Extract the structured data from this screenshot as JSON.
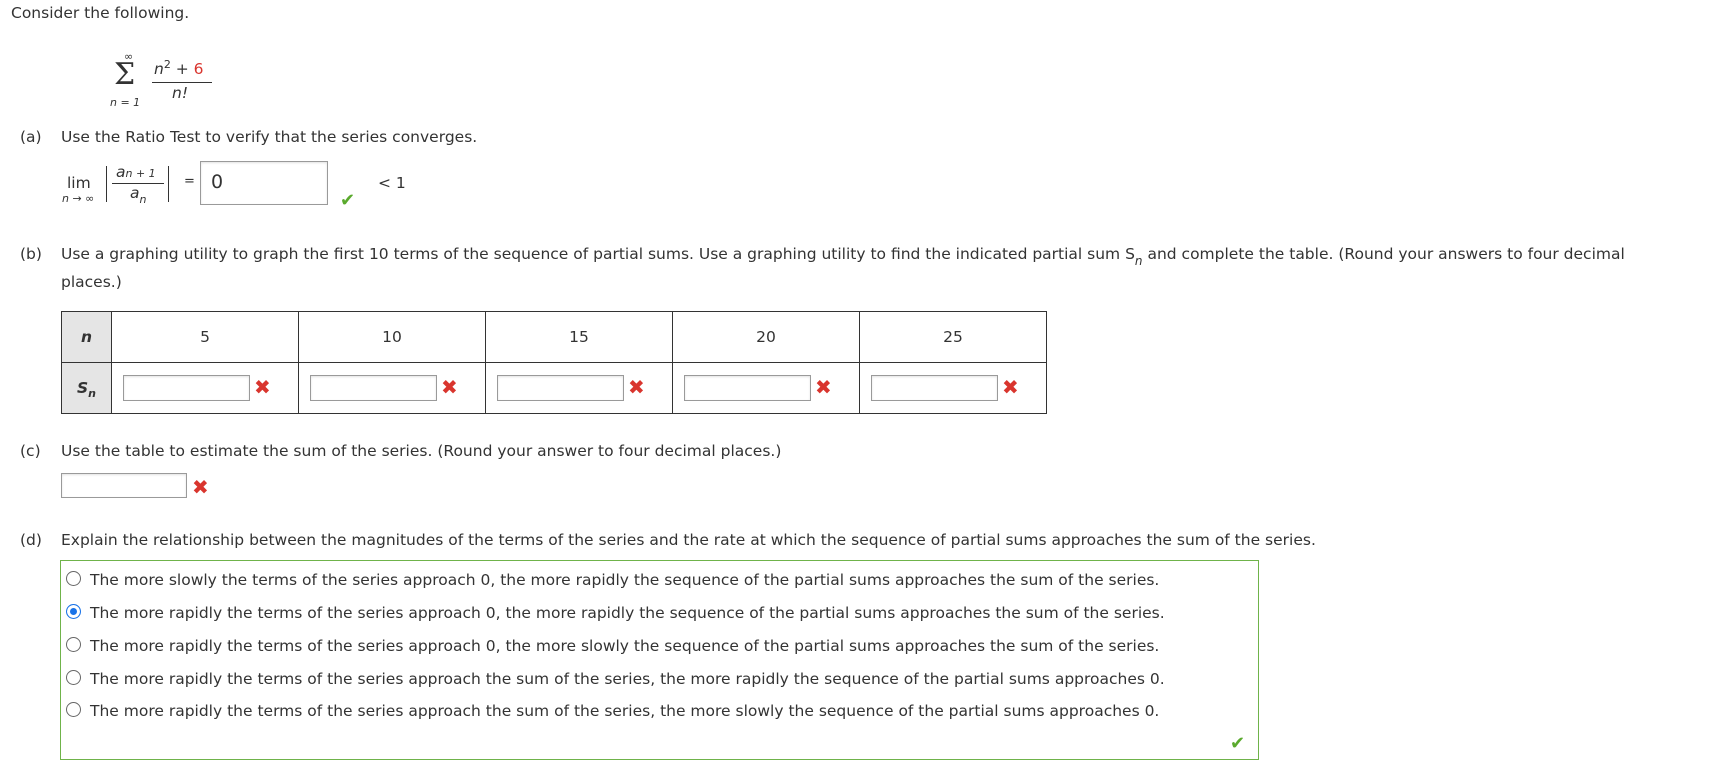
{
  "intro": "Consider the following.",
  "series": {
    "upper": "∞",
    "sigma": "Σ",
    "lower": "n = 1",
    "num_base": "n",
    "num_exp": "2",
    "num_plus": " + ",
    "num_const": "6",
    "den": "n!"
  },
  "part_a": {
    "label": "(a)",
    "text": "Use the Ratio Test to verify that the series converges.",
    "lim": "lim",
    "lim_sub": "n → ∞",
    "ratio_num": "a",
    "ratio_num_sub": "n + 1",
    "ratio_den": "a",
    "ratio_den_sub": "n",
    "equals": "=",
    "answer": "0",
    "compare": "< 1",
    "status": "correct"
  },
  "part_b": {
    "label": "(b)",
    "text_1": "Use a graphing utility to graph the first 10 terms of the sequence of partial sums. Use a graphing utility to find the indicated partial sum S",
    "text_sub": "n",
    "text_2": " and complete the table. (Round your answers to four decimal",
    "text_3": "places.)",
    "row_header_n": "n",
    "row_header_s": "S",
    "row_header_s_sub": "n",
    "columns": [
      "5",
      "10",
      "15",
      "20",
      "25"
    ],
    "values": [
      "",
      "",
      "",
      "",
      ""
    ],
    "status": "incorrect"
  },
  "part_c": {
    "label": "(c)",
    "text": "Use the table to estimate the sum of the series. (Round your answer to four decimal places.)",
    "value": "",
    "status": "incorrect"
  },
  "part_d": {
    "label": "(d)",
    "text": "Explain the relationship between the magnitudes of the terms of the series and the rate at which the sequence of partial sums approaches the sum of the series.",
    "options": [
      "The more slowly the terms of the series approach 0, the more rapidly the sequence of the partial sums approaches the sum of the series.",
      "The more rapidly the terms of the series approach 0, the more rapidly the sequence of the partial sums approaches the sum of the series.",
      "The more rapidly the terms of the series approach 0, the more slowly the sequence of the partial sums approaches the sum of the series.",
      "The more rapidly the terms of the series approach the sum of the series, the more rapidly the sequence of the partial sums approaches 0.",
      "The more rapidly the terms of the series approach the sum of the series, the more slowly the sequence of the partial sums approaches 0."
    ],
    "selected_index": 1,
    "status": "correct"
  },
  "colors": {
    "correct": "#5aaa2d",
    "incorrect": "#d9352e",
    "radio_selected": "#1a73e8"
  }
}
